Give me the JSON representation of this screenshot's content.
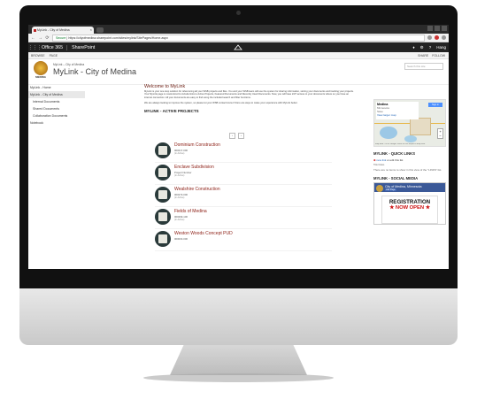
{
  "browser": {
    "tab_title": "MyLink - City of Medina",
    "url_secure": "Secure",
    "url": "https://cityofmedina.sharepoint.com/sites/mylink/SitePages/Home.aspx"
  },
  "suite": {
    "app": "Office 365",
    "product": "SharePoint",
    "user": "Hang"
  },
  "ribbon": {
    "items": [
      "BROWSE",
      "PAGE"
    ],
    "right": [
      "SHARE",
      "FOLLOW"
    ]
  },
  "header": {
    "logo_text": "MEDINA",
    "breadcrumb": "MyLink – City of Medina",
    "title": "MyLink - City of Medina",
    "search_placeholder": "Search this site"
  },
  "leftnav": {
    "items": [
      {
        "label": "MyLink - Home"
      },
      {
        "label": "MyLink - City of Medina"
      },
      {
        "label": "Internal Documents"
      },
      {
        "label": "Shared Documents"
      },
      {
        "label": "Collaboration Documents"
      },
      {
        "label": "Notebook"
      }
    ]
  },
  "main": {
    "welcome": "Welcome to MyLink",
    "para1": "MyLink is your one stop solution for referencing all your WSB projects and files. You and your WSB team will use the system for sharing information, storing your documents and tracking your projects. Your MyLink page is customized to include links to Active Projects, Featured Documents and Recently Used Documents. Now, you will have 24/7 access to your documents where so you have an internet connection. All your documents are easy to find using the included search and filter functions.",
    "para2": "We are always looking to improve the system, so please let your WSB contact know if there are ways to make your experience with MyLink better.",
    "projects_heading": "MYLINK - ACTIVE PROJECTS",
    "pager": [
      "‹",
      "›"
    ],
    "projects": [
      {
        "title": "Dominium Construction",
        "number": "000217-000",
        "status": "(in Active)"
      },
      {
        "title": "Enclave Subdivision",
        "number": "Project Number",
        "status": "(in Active)"
      },
      {
        "title": "Wealshire Construction",
        "number": "000273-000",
        "status": "(in Active)"
      },
      {
        "title": "Fields of Medina",
        "number": "000299-100",
        "status": "(in Active)"
      },
      {
        "title": "Weston Woods Concept PUD",
        "number": "000003-000",
        "status": ""
      }
    ]
  },
  "right": {
    "map_title": "Medina",
    "map_subtitle": "Minnesota",
    "map_save": "Save",
    "map_link": "View larger map",
    "map_signin": "Sign in",
    "map_footer": "Map data ©2018 Google   Terms of Use   Report a map error",
    "quick_heading": "MYLINK - QUICK LINKS",
    "quick_new": "new link",
    "quick_edit": "or edit this list",
    "quick_sub": "Title    Notes",
    "quick_empty": "There are no items to show in this view of the \"LINKS\" list.",
    "social_heading": "MYLINK - SOCIAL MEDIA",
    "fb_name": "City of Medina, Minnesota",
    "fb_like": "Like Page",
    "poster_line1": "REGISTRATION",
    "poster_line2": "★ NOW OPEN ★"
  },
  "colors": {
    "accent": "#8a1a10",
    "suitebar": "#222222",
    "facebook": "#3b5998"
  }
}
